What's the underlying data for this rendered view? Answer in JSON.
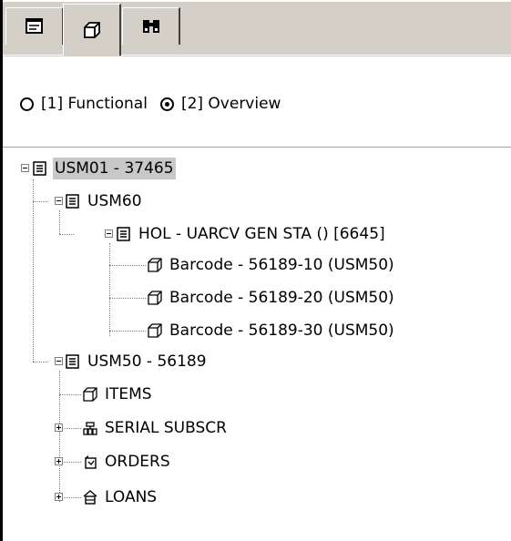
{
  "tabs": [
    {
      "icon": "record-list-icon"
    },
    {
      "icon": "cube-icon"
    },
    {
      "icon": "binoculars-icon"
    }
  ],
  "view_mode": {
    "options": [
      {
        "label": "[1] Functional",
        "selected": false
      },
      {
        "label": "[2] Overview",
        "selected": true
      }
    ]
  },
  "tree": {
    "root": {
      "label": "USM01 - 37465",
      "icon": "record-icon",
      "expanded": true,
      "selected": true
    },
    "usm60": {
      "label": "USM60",
      "icon": "record-icon",
      "expanded": true
    },
    "hol": {
      "label": "HOL - UARCV GEN STA () [6645]",
      "icon": "record-icon",
      "expanded": true
    },
    "barcodes": [
      {
        "label": "Barcode - 56189-10 (USM50)",
        "icon": "cube-icon"
      },
      {
        "label": "Barcode - 56189-20 (USM50)",
        "icon": "cube-icon"
      },
      {
        "label": "Barcode - 56189-30 (USM50)",
        "icon": "cube-icon"
      }
    ],
    "usm50": {
      "label": "USM50 - 56189",
      "icon": "record-icon",
      "expanded": true
    },
    "items": {
      "label": "ITEMS",
      "icon": "cube-icon"
    },
    "serial": {
      "label": "SERIAL SUBSCR",
      "icon": "serial-subscription-icon",
      "expanded": false
    },
    "orders": {
      "label": "ORDERS",
      "icon": "orders-icon",
      "expanded": false
    },
    "loans": {
      "label": "LOANS",
      "icon": "loans-icon",
      "expanded": false
    }
  }
}
